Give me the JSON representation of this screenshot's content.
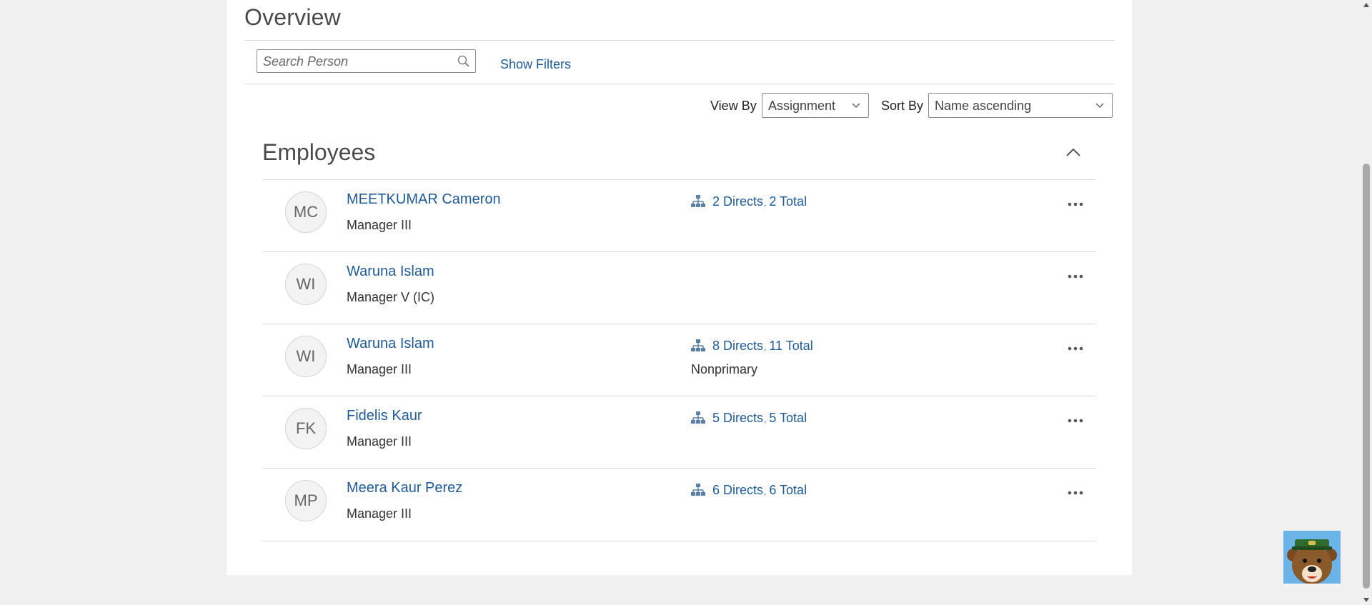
{
  "page": {
    "title": "Overview"
  },
  "search": {
    "placeholder": "Search Person"
  },
  "filters": {
    "show_filters_label": "Show Filters"
  },
  "view_by": {
    "label": "View By",
    "value": "Assignment"
  },
  "sort_by": {
    "label": "Sort By",
    "value": "Name ascending"
  },
  "employees": {
    "title": "Employees",
    "rows": [
      {
        "initials": "MC",
        "name": "MEETKUMAR Cameron",
        "job": "Manager III",
        "directs": "2 Directs",
        "total": "2 Total",
        "note": ""
      },
      {
        "initials": "WI",
        "name": "Waruna Islam",
        "job": "Manager V (IC)",
        "directs": "",
        "total": "",
        "note": ""
      },
      {
        "initials": "WI",
        "name": "Waruna Islam",
        "job": "Manager III",
        "directs": "8 Directs",
        "total": "11 Total",
        "note": "Nonprimary"
      },
      {
        "initials": "FK",
        "name": "Fidelis Kaur",
        "job": "Manager III",
        "directs": "5 Directs",
        "total": "5 Total",
        "note": ""
      },
      {
        "initials": "MP",
        "name": "Meera Kaur Perez",
        "job": "Manager III",
        "directs": "6 Directs",
        "total": "6 Total",
        "note": ""
      }
    ]
  },
  "icons": {
    "search": "search-icon",
    "org": "org-chart-icon",
    "more": "more-actions-icon",
    "collapse": "chevron-up-icon",
    "dropdown": "chevron-down-icon"
  },
  "colors": {
    "link": "#1f5a96",
    "panel": "#ffffff",
    "background": "#f1f0f0"
  }
}
